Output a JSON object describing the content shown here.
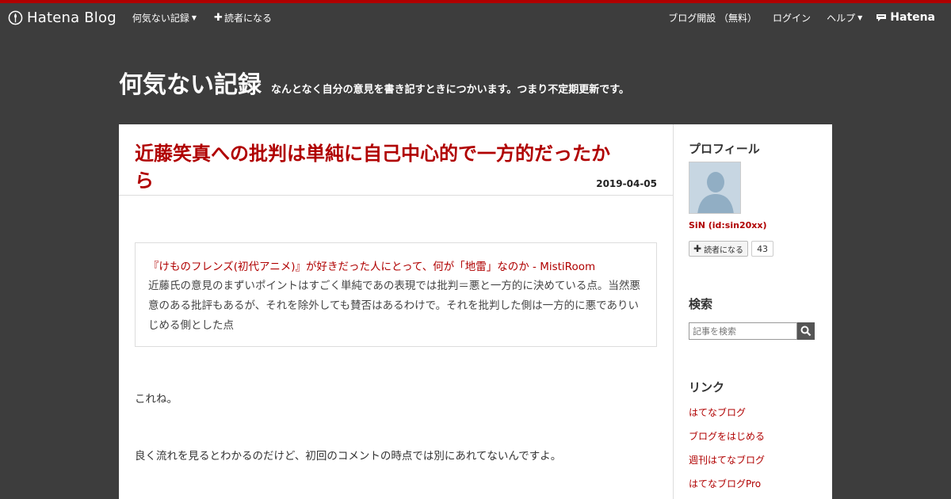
{
  "global_header": {
    "brand": "Hatena Blog",
    "blog_name": "何気ない記録",
    "subscribe": "読者になる",
    "open_blog": "ブログ開設 （無料）",
    "login": "ログイン",
    "help": "ヘルプ",
    "hatena": "Hatena"
  },
  "blog": {
    "title": "何気ない記録",
    "description": "なんとなく自分の意見を書き記すときにつかいます。つまり不定期更新です。"
  },
  "entry": {
    "title": "近藤笑真への批判は単純に自己中心的で一方的だったから",
    "date": "2019-04-05",
    "quote_link": "『けものフレンズ(初代アニメ)』が好きだった人にとって、何が「地雷」なのか - MistiRoom",
    "quote_text": "近藤氏の意見のまずいポイントはすごく単純であの表現では批判＝悪と一方的に決めている点。当然悪意のある批評もあるが、それを除外しても賛否はあるわけで。それを批判した側は一方的に悪でありいじめる側とした点",
    "para1": "これね。",
    "para2": "良く流れを見るとわかるのだけど、初回のコメントの時点では別にあれてないんですよ。"
  },
  "sidebar": {
    "profile_title": "プロフィール",
    "profile_name": "SiN (id:sin20xx)",
    "subscribe_label": "読者になる",
    "subscriber_count": "43",
    "search_title": "検索",
    "search_placeholder": "記事を検索",
    "links_title": "リンク",
    "links": [
      "はてなブログ",
      "ブログをはじめる",
      "週刊はてなブログ",
      "はてなブログPro"
    ]
  },
  "colors": {
    "accent": "#b00000",
    "background": "#3d3d3d"
  }
}
